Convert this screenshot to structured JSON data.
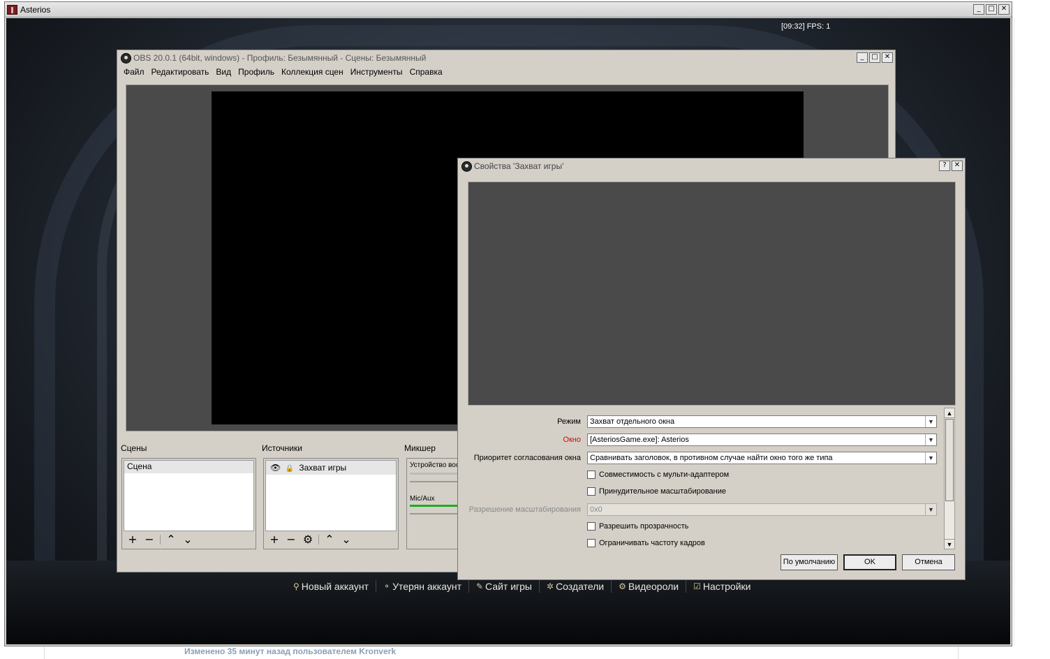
{
  "game_window": {
    "title": "Asterios",
    "hud": "[09:32]  FPS: 1",
    "menu": [
      {
        "icon": "user-icon",
        "glyph": "⚲",
        "label": "Новый аккаунт"
      },
      {
        "icon": "lost-account-icon",
        "glyph": "⚬",
        "label": "Утерян аккаунт"
      },
      {
        "icon": "site-icon",
        "glyph": "✎",
        "label": "Сайт игры"
      },
      {
        "icon": "creators-icon",
        "glyph": "✲",
        "label": "Создатели"
      },
      {
        "icon": "video-icon",
        "glyph": "⚙",
        "label": "Видеороли"
      },
      {
        "icon": "settings-icon",
        "glyph": "☑",
        "label": "Настройки"
      }
    ]
  },
  "obs": {
    "title": "OBS 20.0.1 (64bit, windows) - Профиль: Безымянный - Сцены: Безымянный",
    "menu": [
      "Файл",
      "Редактировать",
      "Вид",
      "Профиль",
      "Коллекция сцен",
      "Инструменты",
      "Справка"
    ],
    "scenes": {
      "label": "Сцены",
      "items": [
        "Сцена"
      ]
    },
    "sources": {
      "label": "Источники",
      "items": [
        "Захват игры"
      ]
    },
    "mixer": {
      "label": "Микшер",
      "channels": [
        "Устройство вос",
        "Mic/Aux"
      ]
    }
  },
  "properties": {
    "title": "Свойства 'Захват игры'",
    "fields": {
      "mode": {
        "label": "Режим",
        "value": "Захват отдельного окна"
      },
      "window": {
        "label": "Окно",
        "value": "[AsteriosGame.exe]: Asterios"
      },
      "priority": {
        "label": "Приоритет согласования окна",
        "value": "Сравнивать заголовок, в противном случае найти окно того же типа"
      },
      "multi_adapter": {
        "label": "Совместимость с мульти-адаптером",
        "checked": false
      },
      "force_scaling": {
        "label": "Принудительное масштабирование",
        "checked": false
      },
      "scale_res": {
        "label": "Разрешение масштабирования",
        "value": "0x0"
      },
      "allow_transparency": {
        "label": "Разрешить прозрачность",
        "checked": false
      },
      "limit_fps": {
        "label": "Ограничивать частоту кадров",
        "checked": false
      }
    },
    "buttons": {
      "defaults": "По умолчанию",
      "ok": "OK",
      "cancel": "Отмена"
    }
  },
  "footer": {
    "text": "Изменено 35 минут назад пользователем Kronverk"
  },
  "colors": {
    "accent_red": "#e00000",
    "preview_gray": "#4a4a4a",
    "dialog_bg": "#d4d0c8",
    "mixer_green": "#1faa1f"
  }
}
